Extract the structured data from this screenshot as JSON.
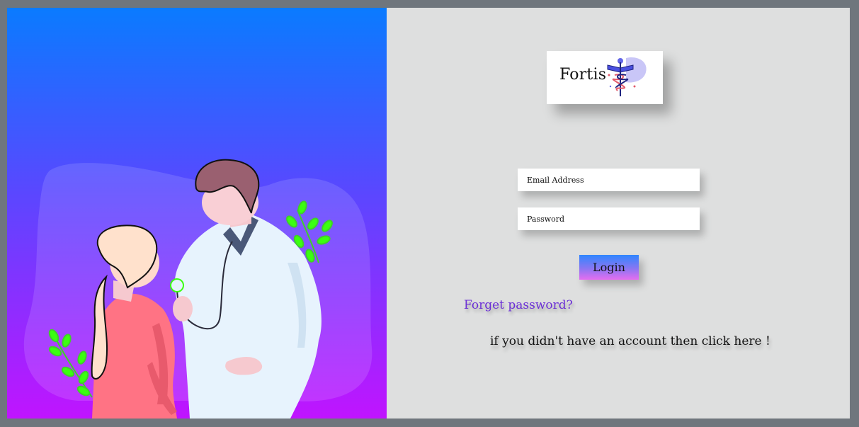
{
  "brand": {
    "name": "Fortis",
    "icon": "caduceus-icon"
  },
  "form": {
    "email_placeholder": "Email Address",
    "password_placeholder": "Password",
    "login_label": "Login",
    "forget_label": "Forget password?",
    "signup_label": "if you didn't have an account then click here !"
  },
  "colors": {
    "gradient_top": "#0a7bff",
    "gradient_mid": "#5a47ff",
    "gradient_bottom": "#c014ff",
    "panel_bg": "#dedfdf",
    "link": "#6b2fd6"
  },
  "illustration": {
    "icon": "doctor-patient-illustration"
  }
}
